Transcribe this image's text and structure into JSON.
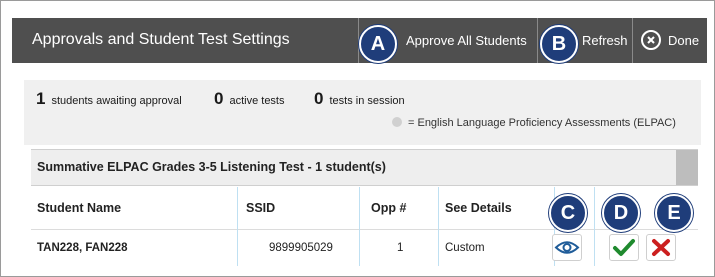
{
  "header": {
    "title": "Approvals and Student Test Settings",
    "approve_all_label": "Approve All Students",
    "refresh_label": "Refresh",
    "done_label": "Done",
    "bg_color": "#4f4f4f"
  },
  "summary": {
    "awaiting_count": "1",
    "awaiting_label": "students awaiting approval",
    "active_count": "0",
    "active_label": "active tests",
    "session_count": "0",
    "session_label": "tests in session",
    "legend_text": "= English Language Proficiency Assessments (ELPAC)"
  },
  "group": {
    "title": "Summative ELPAC Grades 3-5 Listening Test - 1 student(s)"
  },
  "table": {
    "columns": [
      "Student Name",
      "SSID",
      "Opp #",
      "See Details"
    ],
    "rows": [
      {
        "name": "TAN228, FAN228",
        "ssid": "9899905029",
        "opp": "1",
        "details": "Custom"
      }
    ]
  },
  "actions": {
    "view_icon": "eye-icon",
    "approve_icon": "checkmark-icon",
    "deny_icon": "x-mark-icon",
    "approve_color": "#1f8a2e",
    "deny_color": "#cc1f1f",
    "view_color": "#1f5c99"
  },
  "callouts": [
    "A",
    "B",
    "C",
    "D",
    "E"
  ],
  "callout_color": "#1f3d7a"
}
